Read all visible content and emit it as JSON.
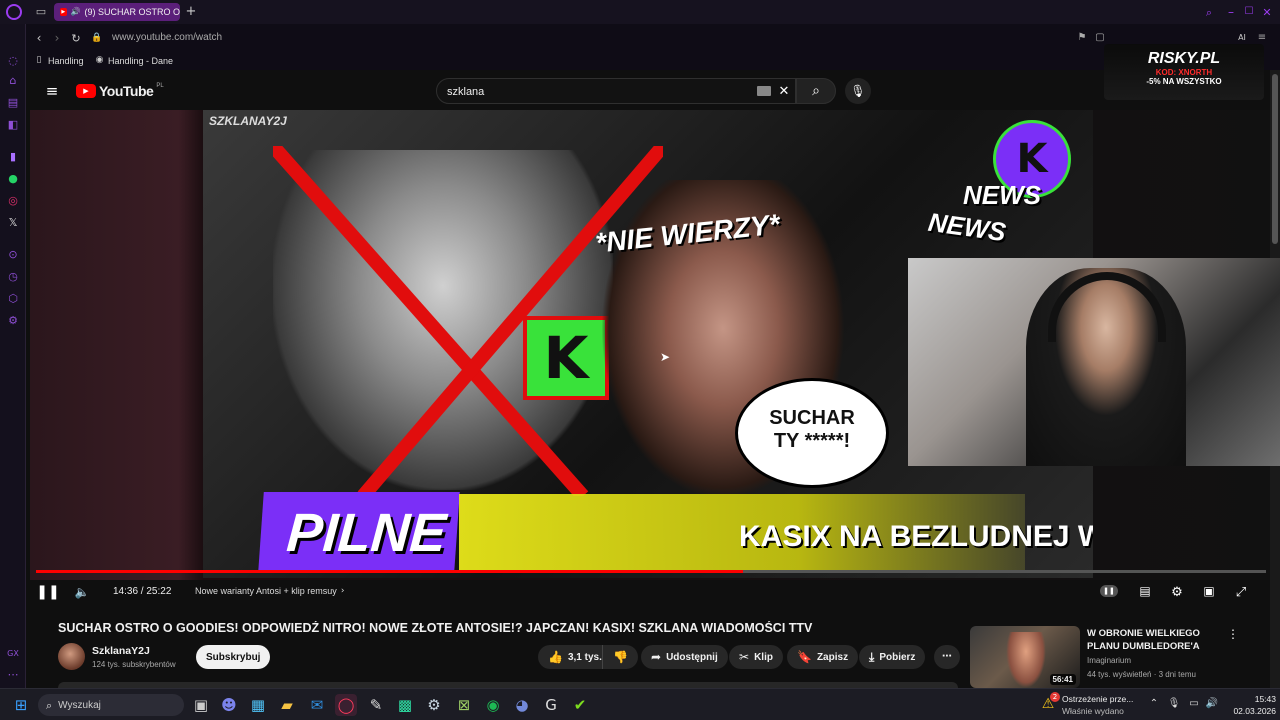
{
  "browser": {
    "tab_title": "(9) SUCHAR OSTRO O",
    "new_tab": "+",
    "url": "www.youtube.com/watch",
    "bookmarks": [
      "Handling",
      "Handling - Dane"
    ]
  },
  "overlay_ad": {
    "brand": "RISKY.PL",
    "code": "KOD: XNORTH",
    "promo": "-5% NA WSZYSTKO"
  },
  "youtube": {
    "logo": "YouTube",
    "region": "PL",
    "search_value": "szklana"
  },
  "thumbnail": {
    "channel_tag": "SZKLANAY2J",
    "nie_wierzy": "*NIE WIERZY*",
    "news": "NEWS",
    "bubble_line1": "SUCHAR",
    "bubble_line2": "TY *****!",
    "pilne": "PILNE",
    "ticker": "KASIX NA BEZLUDNEJ WYSPI"
  },
  "player": {
    "progress": 0.575,
    "time": "14:36 / 25:22",
    "chapter": "Nowe warianty Antosi + klip remsuy"
  },
  "video": {
    "title": "SUCHAR OSTRO O GOODIES! ODPOWIEDŹ NITRO! NOWE ZŁOTE ANTOSIE!? JAPCZAN! KASIX! SZKLANA WIADOMOŚCI TTV",
    "channel": "SzklanaY2J",
    "subscribers": "124 tys. subskrybentów",
    "subscribe": "Subskrybuj",
    "likes": "3,1 tys.",
    "share": "Udostępnij",
    "clip": "Klip",
    "save": "Zapisz",
    "download": "Pobierz"
  },
  "recommendation": {
    "title": "W OBRONIE WIELKIEGO PLANU DUMBLEDORE'A",
    "channel": "Imaginarium",
    "meta": "44 tys. wyświetleń · 3 dni temu",
    "duration": "56:41"
  },
  "taskbar": {
    "search": "Wyszukaj",
    "notif_title": "Ostrzeżenie prze...",
    "notif_sub": "Właśnie wydano",
    "notif_badge": "2",
    "time": "15:43",
    "date": "02.03.2026"
  },
  "colors": {
    "accent": "#ff0000",
    "opera": "#9b3cf0",
    "pilne_purple": "#7b2ff7",
    "ticker_yellow": "#f4f21a"
  }
}
